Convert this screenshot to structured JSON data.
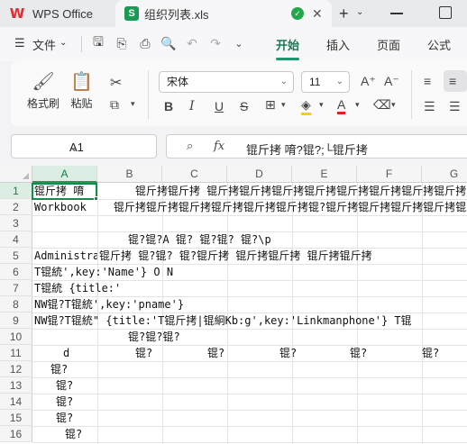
{
  "titlebar": {
    "app_tab": "WPS Office",
    "file_tab": "组织列表.xls"
  },
  "menubar": {
    "file_menu": "文件",
    "tabs": [
      "开始",
      "插入",
      "页面",
      "公式"
    ],
    "active_tab": "开始"
  },
  "ribbon": {
    "format_painter": "格式刷",
    "paste": "粘贴",
    "font_name": "宋体",
    "font_size": "11"
  },
  "formula_bar": {
    "cell_ref": "A1",
    "fx_label": "fx",
    "content": "锟斤拷 唷?锟?;└锟斤拷"
  },
  "sheet": {
    "columns": [
      "A",
      "B",
      "C",
      "D",
      "E",
      "F",
      "G"
    ],
    "rows": [
      "1",
      "2",
      "3",
      "4",
      "5",
      "6",
      "7",
      "8",
      "9",
      "10",
      "11",
      "12",
      "13",
      "14",
      "15",
      "16"
    ],
    "cells": {
      "r1a": "锟斤拷 唷",
      "r1b": "锟斤拷锟斤拷 锟斤拷锟斤拷锟斤拷锟斤拷锟斤拷锟斤拷锟斤拷锟斤拷",
      "r2a": "Workbook",
      "r2b": "锟斤拷锟斤拷锟斤拷锟斤拷锟斤拷锟斤拷锟?锟斤拷锟斤拷锟斤拷锟斤拷锟斤拷",
      "r4b": "锟?锟?A 锟? 锟?锟? 锟?\\p",
      "r5a": "Administrator",
      "r5b": "锟斤拷 锟?锟?  锟?锟斤拷  锟斤拷锟斤拷  锟斤拷锟斤拷",
      "r6a": "T锟統',key:'Name'}    O N",
      "r7a": "T锟統  {title:'",
      "r8a": "NW锟?T锟統',key:'pname'}",
      "r9a": "NW锟?T锟統\" {title:'T锟斤拷|锟絅Kb:g',key:'Linkmanphone'}  T锟",
      "r10b": "锟?锟?锟?",
      "r11a": "d",
      "r11c": [
        "锟?",
        "锟?",
        "锟?",
        "锟?",
        "锟?"
      ],
      "r12a": "锟?",
      "r13a": "锟?",
      "r14a": "锟?",
      "r15a": "锟?",
      "r16a": "锟?"
    }
  }
}
